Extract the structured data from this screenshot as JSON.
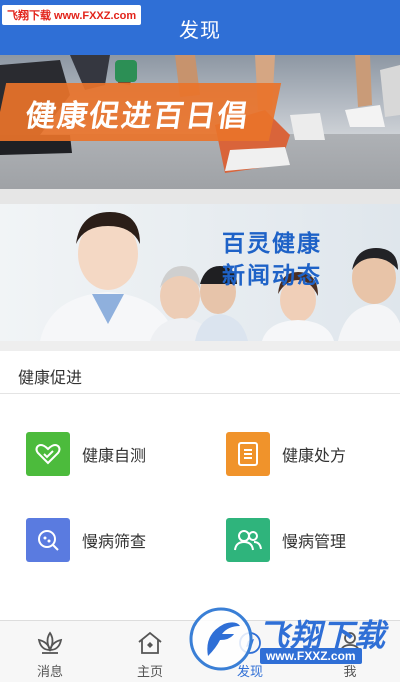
{
  "header": {
    "title": "发现",
    "watermark": "飞翔下载 www.FXXZ.com"
  },
  "banners": [
    {
      "text": "健康促进百日倡"
    },
    {
      "line1": "百灵健康",
      "line2": "新闻动态"
    }
  ],
  "section": {
    "title": "健康促进",
    "items": [
      {
        "label": "健康自测",
        "icon": "heart-check-icon",
        "color": "#4cbb3c"
      },
      {
        "label": "健康处方",
        "icon": "prescription-list-icon",
        "color": "#f0932b"
      },
      {
        "label": "慢病筛查",
        "icon": "screening-search-icon",
        "color": "#5a7be0"
      },
      {
        "label": "慢病管理",
        "icon": "people-manage-icon",
        "color": "#2fb47c"
      }
    ]
  },
  "tabbar": {
    "tabs": [
      {
        "label": "消息",
        "icon": "lotus-icon"
      },
      {
        "label": "主页",
        "icon": "home-icon"
      },
      {
        "label": "发现",
        "icon": "discover-icon",
        "active": true
      },
      {
        "label": "我",
        "icon": "person-icon"
      }
    ]
  },
  "watermark_bottom": {
    "text": "飞翔下载",
    "url": "www.FXXZ.com"
  },
  "colors": {
    "primary": "#2f6fd6",
    "accent_orange": "#e9732a"
  }
}
